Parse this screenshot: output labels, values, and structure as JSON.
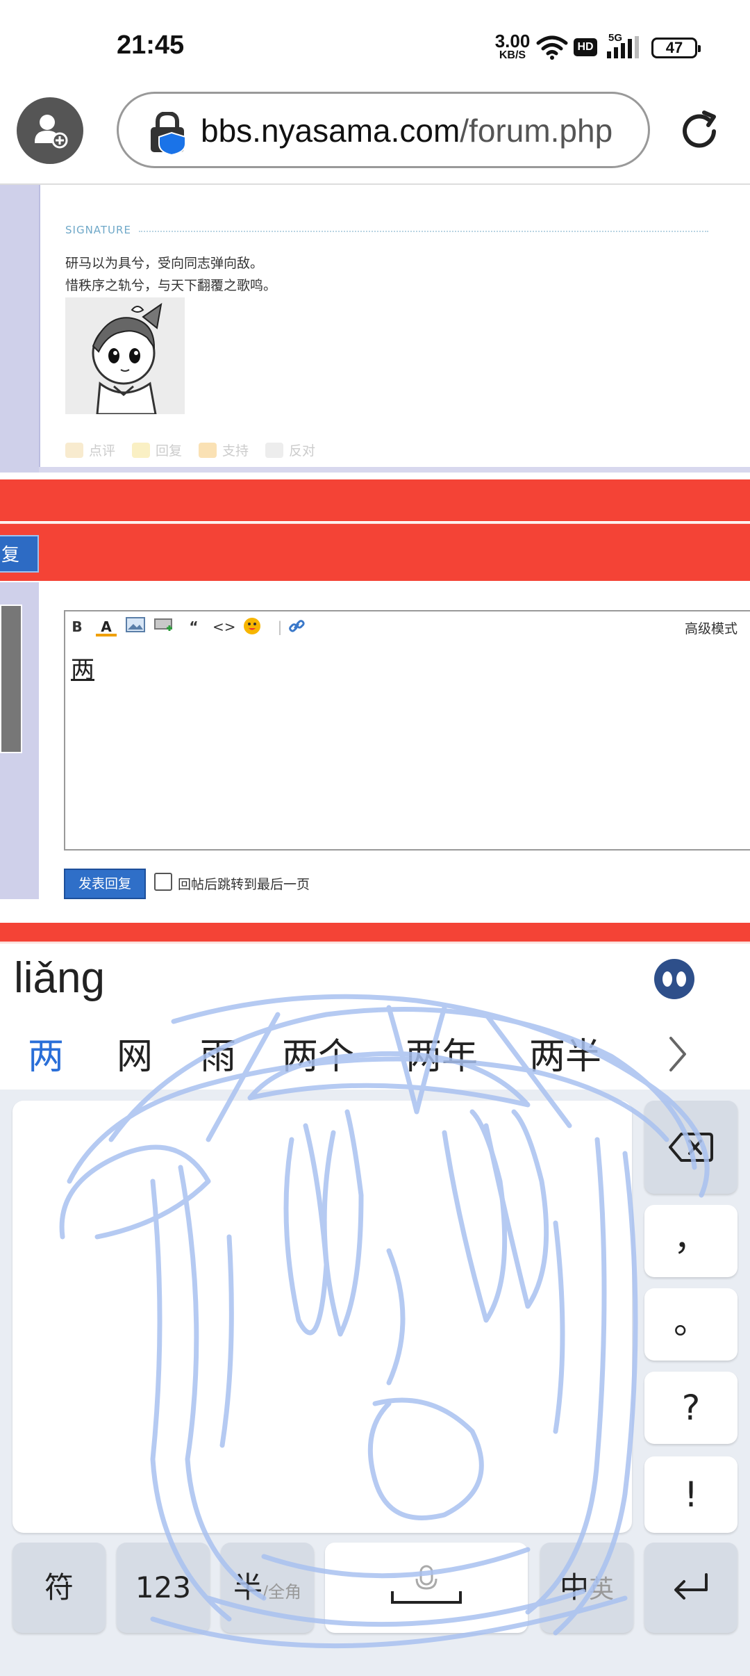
{
  "status_bar": {
    "time": "21:45",
    "net_speed_value": "3.00",
    "net_speed_unit": "KB/S",
    "hd_label": "HD",
    "network_label": "5G",
    "battery": "47"
  },
  "browser": {
    "url_host": "bbs.nyasama.com",
    "url_path": "/forum.php"
  },
  "post": {
    "signature_label": "SIGNATURE",
    "signature_lines": [
      "研马以为具兮，受向同志弹向敌。",
      "惜秩序之轨兮，与天下翻覆之歌鸣。"
    ],
    "actions": [
      "点评",
      "回复",
      "支持",
      "反对"
    ]
  },
  "reply_tab_label": "复",
  "editor": {
    "advanced_mode": "高级模式",
    "content": "两",
    "submit_label": "发表回复",
    "jump_checkbox_label": "回帖后跳转到最后一页",
    "jump_checked": false
  },
  "ime": {
    "pinyin": "liǎng",
    "candidates": [
      "两",
      "网",
      "雨",
      "两个",
      "两年",
      "两半"
    ],
    "side_keys": [
      "，",
      "。",
      "?",
      "!"
    ],
    "bottom_keys": {
      "symbols": "符",
      "numbers": "123",
      "half": "半",
      "full": "/全角",
      "chinese": "中",
      "english": "英"
    },
    "stroke_color": "#a9c1f0"
  },
  "colors": {
    "accent_red": "#f44336",
    "button_blue": "#2f6fc8",
    "candidate_blue": "#2a6fd8"
  }
}
